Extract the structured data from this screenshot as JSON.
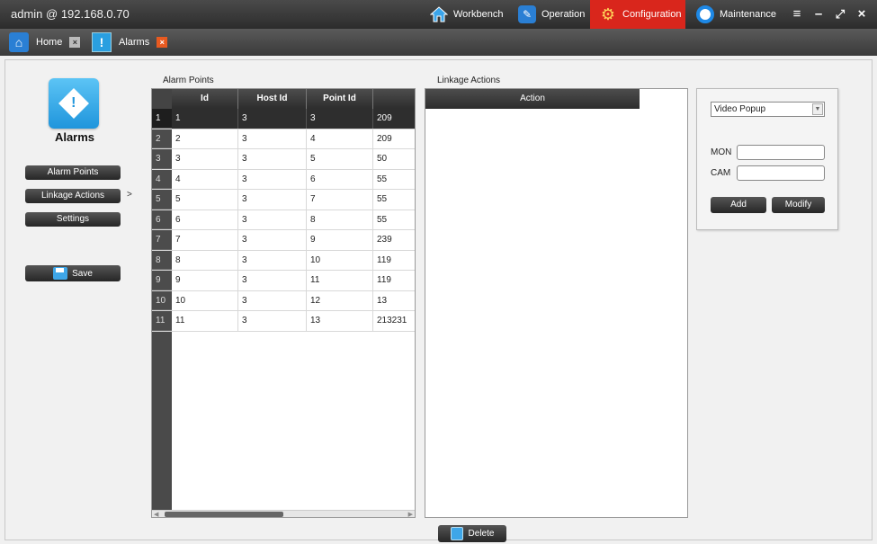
{
  "window": {
    "title": "admin @ 192.168.0.70",
    "nav": {
      "workbench": "Workbench",
      "operation": "Operation",
      "configuration": "Configuration",
      "maintenance": "Maintenance"
    },
    "active_nav_color": "#d9261c"
  },
  "tabs": [
    {
      "label": "Home",
      "icon": "home-icon"
    },
    {
      "label": "Alarms",
      "icon": "alarm-icon"
    }
  ],
  "sidebar": {
    "module_title": "Alarms",
    "items": [
      {
        "label": "Alarm Points"
      },
      {
        "label": "Linkage Actions",
        "indicator": ">"
      },
      {
        "label": "Settings"
      }
    ],
    "save_label": "Save"
  },
  "alarm_points": {
    "section_label": "Alarm Points",
    "columns": [
      "Id",
      "Host Id",
      "Point Id",
      ""
    ],
    "rows": [
      {
        "n": "1",
        "id": "1",
        "host": "3",
        "point": "3",
        "extra": "209",
        "selected": true
      },
      {
        "n": "2",
        "id": "2",
        "host": "3",
        "point": "4",
        "extra": "209"
      },
      {
        "n": "3",
        "id": "3",
        "host": "3",
        "point": "5",
        "extra": "50"
      },
      {
        "n": "4",
        "id": "4",
        "host": "3",
        "point": "6",
        "extra": "55"
      },
      {
        "n": "5",
        "id": "5",
        "host": "3",
        "point": "7",
        "extra": "55"
      },
      {
        "n": "6",
        "id": "6",
        "host": "3",
        "point": "8",
        "extra": "55"
      },
      {
        "n": "7",
        "id": "7",
        "host": "3",
        "point": "9",
        "extra": "239"
      },
      {
        "n": "8",
        "id": "8",
        "host": "3",
        "point": "10",
        "extra": "119"
      },
      {
        "n": "9",
        "id": "9",
        "host": "3",
        "point": "11",
        "extra": "119"
      },
      {
        "n": "10",
        "id": "10",
        "host": "3",
        "point": "12",
        "extra": "13"
      },
      {
        "n": "11",
        "id": "11",
        "host": "3",
        "point": "13",
        "extra": "213231"
      }
    ]
  },
  "linkage": {
    "section_label": "Linkage Actions",
    "column": "Action",
    "delete_label": "Delete"
  },
  "form": {
    "action_type": "Video Popup",
    "mon_label": "MON",
    "cam_label": "CAM",
    "mon_value": "",
    "cam_value": "",
    "add_label": "Add",
    "modify_label": "Modify"
  }
}
